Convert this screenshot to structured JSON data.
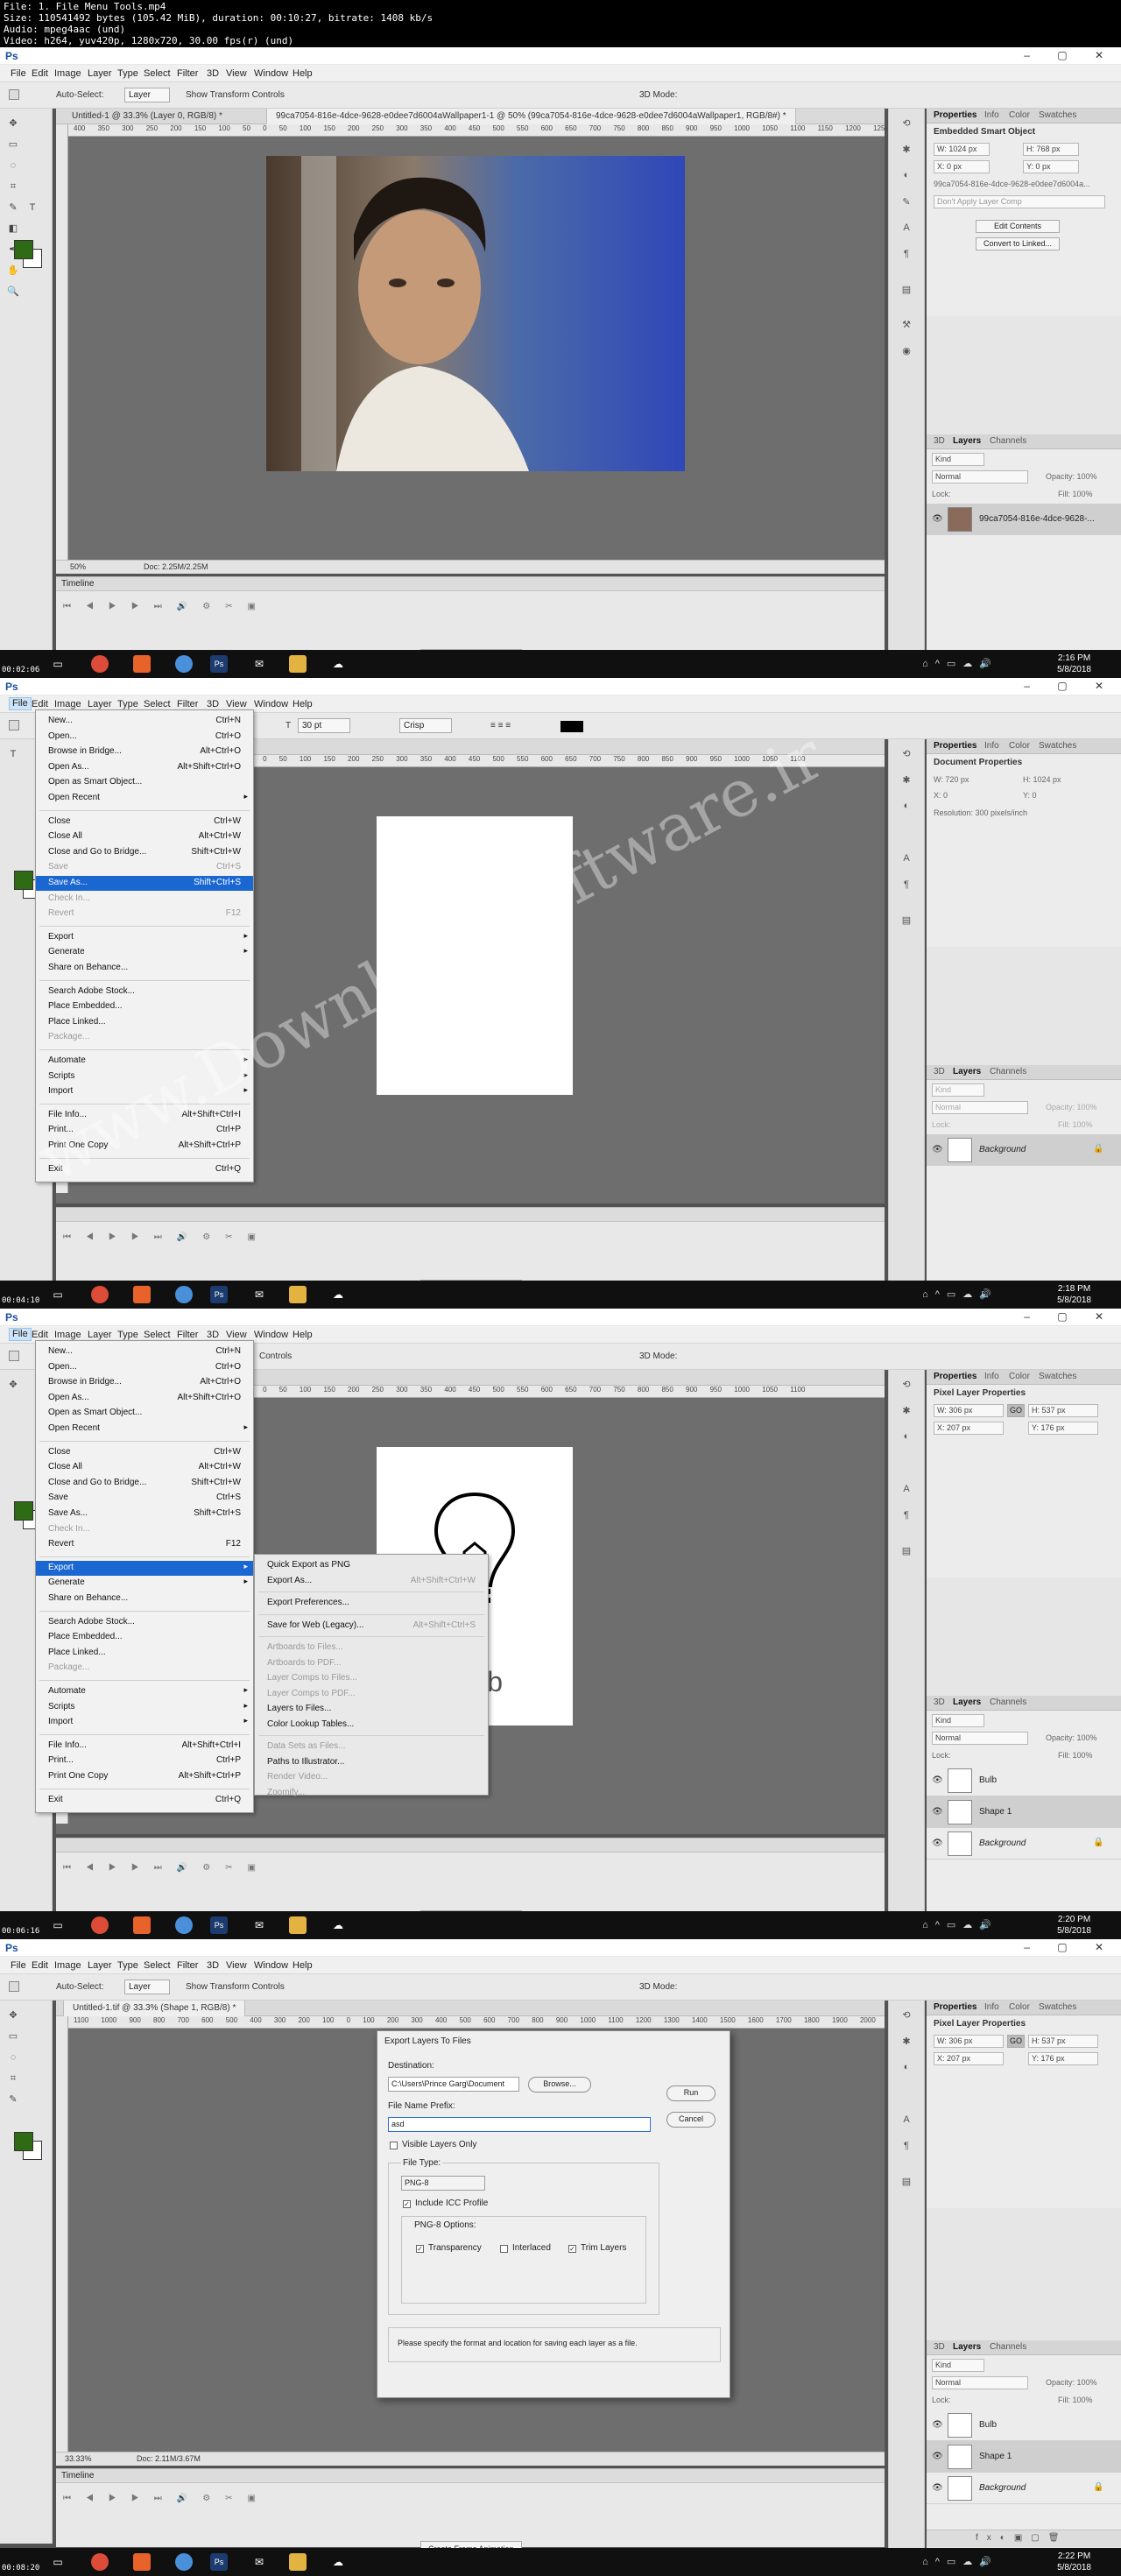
{
  "video_info": {
    "file": "File: 1. File Menu Tools.mp4",
    "size": "Size: 110541492 bytes (105.42 MiB), duration: 00:10:27, bitrate: 1408 kb/s",
    "audio": "Audio: mpeg4aac (und)",
    "video": "Video: h264, yuv420p, 1280x720, 30.00 fps(r) (und)"
  },
  "app": {
    "logo": "Ps",
    "window_controls": "– ▢ ✕"
  },
  "menus": [
    "File",
    "Edit",
    "Image",
    "Layer",
    "Type",
    "Select",
    "Filter",
    "3D",
    "View",
    "Window",
    "Help"
  ],
  "options_move": {
    "auto_select": "Auto-Select:",
    "layer_select": "Layer",
    "show_transform": "Show Transform Controls",
    "mode_3d": "3D Mode:"
  },
  "frames": [
    {
      "time": "00:02:06",
      "doc_tab_1": "Untitled-1 @ 33.3% (Layer 0, RGB/8) *",
      "doc_tab_2": "99ca7054-816e-4dce-9628-e0dee7d6004aWallpaper1-1 @ 50% (99ca7054-816e-4dce-9628-e0dee7d6004aWallpaper1, RGB/8#) *",
      "ruler": "400 350 300 250 200 150 100 50 0 50 100 150 200 250 300 350 400 450 500 550 600 650 700 750 800 850 900 950 1000 1050 1100 1150 1200 1250 1300 1350 1400",
      "zoom": "50%",
      "doc_info": "Doc: 2.25M/2.25M",
      "properties": {
        "title": "Embedded Smart Object",
        "w": "W: 1024 px",
        "h": "H: 768 px",
        "x": "X: 0 px",
        "y": "Y: 0 px",
        "filename": "99ca7054-816e-4dce-9628-e0dee7d6004a...",
        "comp": "Don't Apply Layer Comp",
        "btn1": "Edit Contents",
        "btn2": "Convert to Linked..."
      },
      "layers": [
        {
          "name": "99ca7054-816e-4dce-9628-..."
        }
      ],
      "clock": {
        "time": "2:16 PM",
        "date": "5/8/2018"
      }
    },
    {
      "time": "00:04:10",
      "options_type": {
        "size": "30 pt",
        "aa": "Crisp"
      },
      "ruler": "400 350 300 250 200 150 100 50 0 50 100 150 200 250 300 350 400 450 500 550 600 650 700 750 800 850 900 950 1000 1050 1100",
      "properties": {
        "title": "Document Properties",
        "w": "W: 720 px",
        "h": "H: 1024 px",
        "x": "X: 0",
        "y": "Y: 0",
        "resolution": "Resolution: 300 pixels/inch"
      },
      "layers": [
        {
          "name": "Background"
        }
      ],
      "file_menu": [
        {
          "label": "New...",
          "shortcut": "Ctrl+N"
        },
        {
          "label": "Open...",
          "shortcut": "Ctrl+O"
        },
        {
          "label": "Browse in Bridge...",
          "shortcut": "Alt+Ctrl+O"
        },
        {
          "label": "Open As...",
          "shortcut": "Alt+Shift+Ctrl+O"
        },
        {
          "label": "Open as Smart Object...",
          "shortcut": ""
        },
        {
          "label": "Open Recent",
          "shortcut": ""
        },
        {
          "label": "Close",
          "shortcut": "Ctrl+W"
        },
        {
          "label": "Close All",
          "shortcut": "Alt+Ctrl+W"
        },
        {
          "label": "Close and Go to Bridge...",
          "shortcut": "Shift+Ctrl+W"
        },
        {
          "label": "Save",
          "shortcut": "Ctrl+S"
        },
        {
          "label": "Save As...",
          "shortcut": "Shift+Ctrl+S"
        },
        {
          "label": "Check In...",
          "shortcut": ""
        },
        {
          "label": "Revert",
          "shortcut": "F12"
        },
        {
          "label": "Export",
          "shortcut": ""
        },
        {
          "label": "Generate",
          "shortcut": ""
        },
        {
          "label": "Share on Behance...",
          "shortcut": ""
        },
        {
          "label": "Search Adobe Stock...",
          "shortcut": ""
        },
        {
          "label": "Place Embedded...",
          "shortcut": ""
        },
        {
          "label": "Place Linked...",
          "shortcut": ""
        },
        {
          "label": "Package...",
          "shortcut": ""
        },
        {
          "label": "Automate",
          "shortcut": ""
        },
        {
          "label": "Scripts",
          "shortcut": ""
        },
        {
          "label": "Import",
          "shortcut": ""
        },
        {
          "label": "File Info...",
          "shortcut": "Alt+Shift+Ctrl+I"
        },
        {
          "label": "Print...",
          "shortcut": "Ctrl+P"
        },
        {
          "label": "Print One Copy",
          "shortcut": "Alt+Shift+Ctrl+P"
        },
        {
          "label": "Exit",
          "shortcut": "Ctrl+Q"
        }
      ],
      "clock": {
        "time": "2:18 PM",
        "date": "5/8/2018"
      }
    },
    {
      "time": "00:06:16",
      "options_controls": "Controls",
      "ruler": "400 350 300 250 200 150 100 50 0 50 100 150 200 250 300 350 400 450 500 550 600 650 700 750 800 850 900 950 1000 1050 1100",
      "bulb_label": "Bulb",
      "properties": {
        "title": "Pixel Layer Properties",
        "w": "W: 306 px",
        "h": "H: 537 px",
        "x": "X: 207 px",
        "y": "Y: 176 px",
        "link": "GO"
      },
      "layers": [
        {
          "name": "Bulb"
        },
        {
          "name": "Shape 1"
        },
        {
          "name": "Background"
        }
      ],
      "export_submenu": [
        {
          "label": "Quick Export as PNG",
          "shortcut": ""
        },
        {
          "label": "Export As...",
          "shortcut": "Alt+Shift+Ctrl+W"
        },
        {
          "label": "Export Preferences...",
          "shortcut": ""
        },
        {
          "label": "Save for Web (Legacy)...",
          "shortcut": "Alt+Shift+Ctrl+S"
        },
        {
          "label": "Artboards to Files...",
          "shortcut": ""
        },
        {
          "label": "Artboards to PDF...",
          "shortcut": ""
        },
        {
          "label": "Layer Comps to Files...",
          "shortcut": ""
        },
        {
          "label": "Layer Comps to PDF...",
          "shortcut": ""
        },
        {
          "label": "Layers to Files...",
          "shortcut": ""
        },
        {
          "label": "Color Lookup Tables...",
          "shortcut": ""
        },
        {
          "label": "Data Sets as Files...",
          "shortcut": ""
        },
        {
          "label": "Paths to Illustrator...",
          "shortcut": ""
        },
        {
          "label": "Render Video...",
          "shortcut": ""
        },
        {
          "label": "Zoomify...",
          "shortcut": ""
        }
      ],
      "clock": {
        "time": "2:20 PM",
        "date": "5/8/2018"
      }
    },
    {
      "time": "00:08:20",
      "doc_tab": "Untitled-1.tif @ 33.3% (Shape 1, RGB/8) *",
      "ruler": "1100 1000 900 800 700 600 500 400 300 200 100 0 100 200 300 400 500 600 700 800 900 1000 1100 1200 1300 1400 1500 1600 1700 1800 1900 2000 2100",
      "zoom": "33.33%",
      "doc_info": "Doc: 2.11M/3.67M",
      "properties": {
        "title": "Pixel Layer Properties",
        "w": "W: 306 px",
        "h": "H: 537 px",
        "x": "X: 207 px",
        "y": "Y: 176 px",
        "link": "GO"
      },
      "layers": [
        {
          "name": "Bulb"
        },
        {
          "name": "Shape 1"
        },
        {
          "name": "Background"
        }
      ],
      "dialog": {
        "title": "Export Layers To Files",
        "destination_label": "Destination:",
        "destination": "C:\\Users\\Prince Garg\\Document",
        "browse": "Browse...",
        "prefix_label": "File Name Prefix:",
        "prefix": "asd",
        "visible_only": "Visible Layers Only",
        "file_type_label": "File Type:",
        "file_type": "PNG-8",
        "icc": "Include ICC Profile",
        "options_label": "PNG-8 Options:",
        "transparency": "Transparency",
        "interlaced": "Interlaced",
        "trim": "Trim Layers",
        "info": "Please specify the format and location for saving each layer as a file.",
        "run": "Run",
        "cancel": "Cancel"
      },
      "clock": {
        "time": "2:22 PM",
        "date": "5/8/2018"
      }
    }
  ],
  "panel_tabs": {
    "properties": [
      "Properties",
      "Info",
      "Color",
      "Swatches"
    ],
    "layers": [
      "3D",
      "Layers",
      "Channels"
    ]
  },
  "layers_ui": {
    "kind": "Kind",
    "blend": "Normal",
    "opacity": "Opacity: 100%",
    "fill": "Fill: 100%",
    "lock": "Lock:"
  },
  "timeline_label": "Timeline",
  "create_frame_animation": "Create Frame Animation",
  "watermark": "www.DownloadSoftware.ir"
}
